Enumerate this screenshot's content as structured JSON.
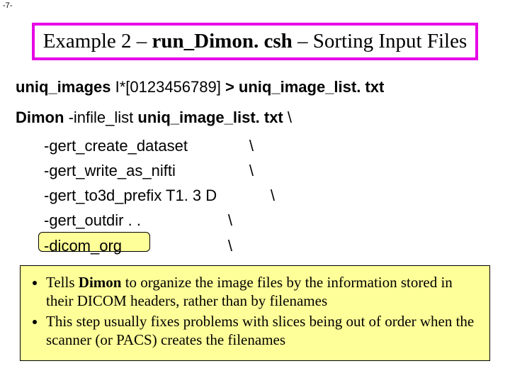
{
  "page_number": "-7-",
  "title": {
    "pre": "Example 2 – ",
    "script": "run_Dimon. csh",
    "post": " – Sorting Input Files"
  },
  "cmd": {
    "uniq_cmd": "uniq_images",
    "uniq_glob": " I*[0123456789] ",
    "redir": "> uniq_image_list. txt",
    "dimon": "Dimon",
    "dimon_args": " -infile_list ",
    "dimon_file": "uniq_image_list. txt",
    "cont": " \\",
    "opts": [
      {
        "flag": "-gert_create_dataset",
        "cont": "\\"
      },
      {
        "flag": "-gert_write_as_nifti",
        "cont": "\\"
      },
      {
        "flag": "-gert_to3d_prefix T1. 3 D",
        "cont": "\\"
      },
      {
        "flag": "-gert_outdir . .",
        "cont": "\\"
      },
      {
        "flag": "-dicom_org",
        "cont": "\\"
      }
    ]
  },
  "info": {
    "b1_pre": "Tells ",
    "b1_bold": "Dimon",
    "b1_post": " to organize the image files by the information stored in their DICOM headers, rather than by filenames",
    "b2": "This step usually fixes problems with slices being out of order when the scanner (or PACS) creates the filenames"
  }
}
